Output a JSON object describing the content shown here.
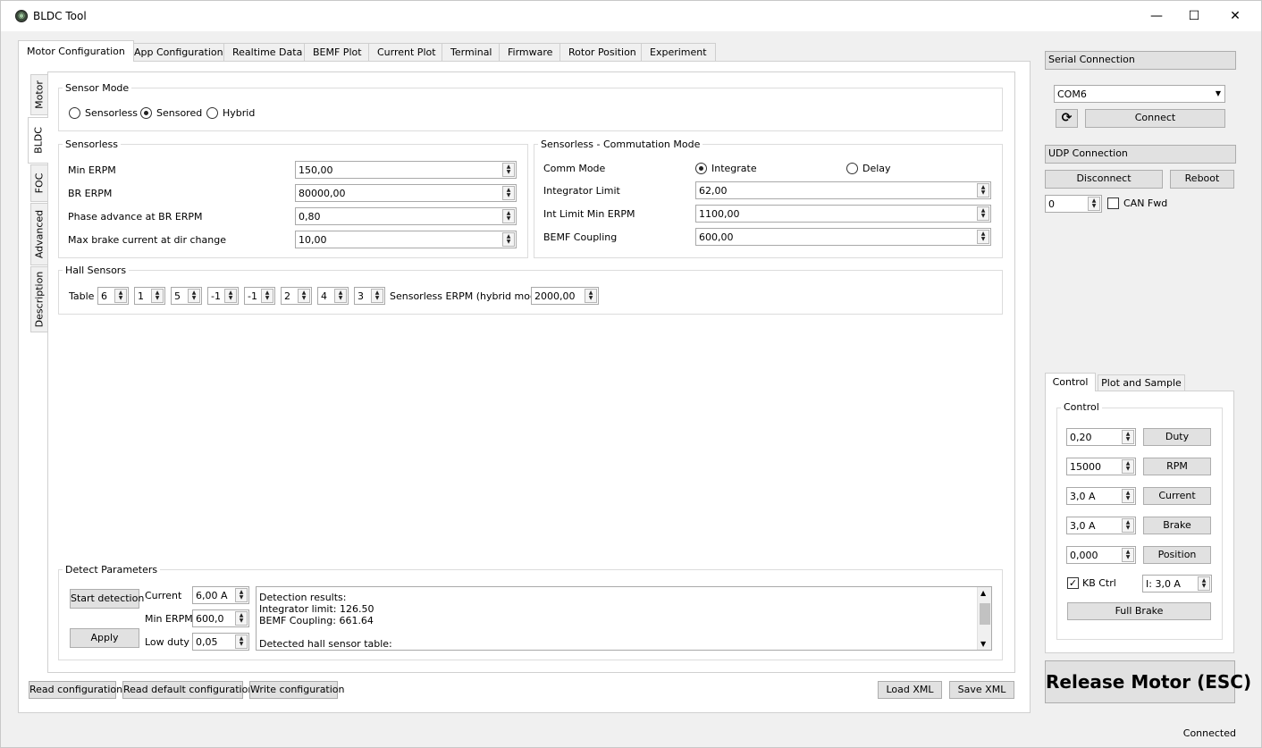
{
  "window": {
    "title": "BLDC Tool",
    "minimize": "—",
    "maximize": "☐",
    "close": "✕",
    "app_icon": "◉"
  },
  "main_tabs": [
    "Motor Configuration",
    "App Configuration",
    "Realtime Data",
    "BEMF Plot",
    "Current Plot",
    "Terminal",
    "Firmware",
    "Rotor Position",
    "Experiment"
  ],
  "side_tabs": [
    "Motor",
    "BLDC",
    "FOC",
    "Advanced",
    "Description"
  ],
  "sensor_mode": {
    "title": "Sensor Mode",
    "options": [
      "Sensorless",
      "Sensored",
      "Hybrid"
    ],
    "selected": "Sensored"
  },
  "sensorless": {
    "title": "Sensorless",
    "rows": [
      {
        "label": "Min ERPM",
        "value": "150,00"
      },
      {
        "label": "BR ERPM",
        "value": "80000,00"
      },
      {
        "label": "Phase advance at BR ERPM",
        "value": "0,80"
      },
      {
        "label": "Max brake current at dir change",
        "value": "10,00"
      }
    ]
  },
  "commutation": {
    "title": "Sensorless - Commutation Mode",
    "comm_mode_label": "Comm Mode",
    "options": [
      "Integrate",
      "Delay"
    ],
    "selected": "Integrate",
    "rows": [
      {
        "label": "Integrator Limit",
        "value": "62,00"
      },
      {
        "label": "Int Limit Min ERPM",
        "value": "1100,00"
      },
      {
        "label": "BEMF Coupling",
        "value": "600,00"
      }
    ]
  },
  "hall": {
    "title": "Hall Sensors",
    "table_label": "Table",
    "table": [
      "6",
      "1",
      "5",
      "-1",
      "-1",
      "2",
      "4",
      "3"
    ],
    "erpm_label": "Sensorless ERPM (hybrid mode)",
    "erpm_value": "2000,00"
  },
  "detect": {
    "title": "Detect Parameters",
    "start_button": "Start detection",
    "apply_button": "Apply",
    "current_label": "Current",
    "current_value": "6,00 A",
    "min_erpm_label": "Min ERPM",
    "min_erpm_value": "600,0",
    "low_duty_label": "Low duty",
    "low_duty_value": "0,05",
    "results": [
      "Detection results:",
      "Integrator limit: 126.50",
      "BEMF Coupling: 661.64",
      "",
      "Detected hall sensor table:"
    ]
  },
  "bottom_buttons": {
    "read": "Read configuration",
    "read_default": "Read default configuration",
    "write": "Write configuration",
    "load_xml": "Load XML",
    "save_xml": "Save XML"
  },
  "serial": {
    "title": "Serial Connection",
    "port": "COM6",
    "refresh_icon": "⟳",
    "connect": "Connect"
  },
  "udp": {
    "title": "UDP Connection",
    "disconnect": "Disconnect",
    "reboot": "Reboot",
    "can_id": "0",
    "can_fwd": "CAN Fwd"
  },
  "control": {
    "tabs": [
      "Control",
      "Plot and Sample"
    ],
    "group_title": "Control",
    "rows": [
      {
        "value": "0,20",
        "button": "Duty"
      },
      {
        "value": "15000",
        "button": "RPM"
      },
      {
        "value": "3,0 A",
        "button": "Current"
      },
      {
        "value": "3,0 A",
        "button": "Brake"
      },
      {
        "value": "0,000",
        "button": "Position"
      }
    ],
    "kb_ctrl": "KB Ctrl",
    "kb_current": "I: 3,0 A",
    "full_brake": "Full Brake"
  },
  "release_motor": "Release Motor (ESC)",
  "status": "Connected"
}
